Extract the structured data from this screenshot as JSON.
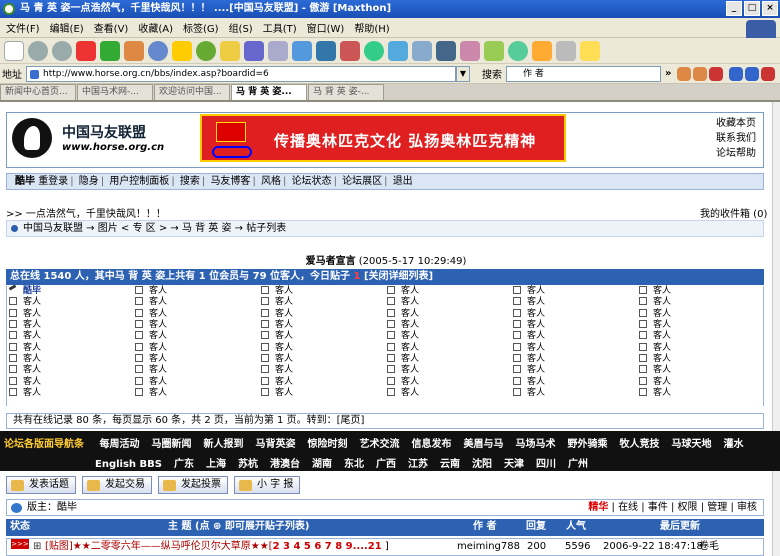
{
  "window": {
    "title": "马 青 英 姿一点浩然气，千里快哉风！！！ ....[中国马友联盟] - 傲游 [Maxthon]"
  },
  "menu": [
    "文件(F)",
    "编辑(E)",
    "查看(V)",
    "收藏(A)",
    "标签(G)",
    "组(S)",
    "工具(T)",
    "窗口(W)",
    "帮助(H)"
  ],
  "address": {
    "label": "地址",
    "url": "http://www.horse.org.cn/bbs/index.asp?boardid=6",
    "search_label": "搜索",
    "search_value": "作 者"
  },
  "tabs": [
    "新闻中心首页...",
    "中国马术网-...",
    "欢迎访问中国...",
    "马 背 英 姿...",
    "马 背 英 姿-..."
  ],
  "site": {
    "name": "中国马友联盟",
    "domain": "www.horse.org.cn",
    "banner_slogan": "传播奥林匹克文化 弘扬奥林匹克精神",
    "side_links": [
      "收藏本页",
      "联系我们",
      "论坛帮助"
    ]
  },
  "nav": [
    "酷毕",
    "重登录",
    "隐身",
    "用户控制面板",
    "搜索",
    "马友博客",
    "风格",
    "论坛状态",
    "论坛展区",
    "退出"
  ],
  "slogan": ">> 一点浩然气，千里快哉风！！！",
  "inbox": "我的收件箱 (0)",
  "breadcrumb": "中国马友联盟 → 图片 < 专 区 > → 马 背 英 姿 → 帖子列表",
  "announcement": {
    "title": "爱马者宣言",
    "date": "(2005-5-17 10:29:49)"
  },
  "online": {
    "prefix": "总在线 1540 人，其中马 背 英 姿上共有 1 位会员与 79 位客人，今日贴子 ",
    "today_posts": "1",
    "link": "[关闭详细列表]"
  },
  "online_grid": {
    "member": "酷毕",
    "guest": "客人"
  },
  "pager": "共有在线记录 80 条，每页显示 60 条，共 2 页，当前为第 1 页。转到：[尾页]",
  "categories": {
    "lead": "论坛各版面导航条",
    "row1": [
      "每周活动",
      "马圈新闻",
      "新人报到",
      "马背英姿",
      "惊险时刻",
      "艺术交流",
      "信息发布",
      "美眉与马",
      "马场马术",
      "野外骑乘",
      "牧人竞技",
      "马球天地",
      "灌水"
    ],
    "row2": [
      "English BBS",
      "广东",
      "上海",
      "苏杭",
      "港澳台",
      "湖南",
      "东北",
      "广西",
      "江苏",
      "云南",
      "沈阳",
      "天津",
      "四川",
      "广州"
    ]
  },
  "actions": [
    "发表话题",
    "发起交易",
    "发起投票",
    "小 字 报"
  ],
  "moderator": {
    "label": "版主：",
    "name": "酷毕",
    "links": [
      "精华",
      "在线",
      "事件",
      "权限",
      "管理",
      "审核"
    ]
  },
  "table_head": {
    "status": "状态",
    "topic": "主 题 (点 ⊕ 即可展开贴子列表)",
    "author": "作 者",
    "replies": "回复",
    "views": "人气",
    "last": "最后更新"
  },
  "post": {
    "badge": ">>>",
    "title": "[贴图]★★二零零六年——纵马呼伦贝尔大草原★★[",
    "pages": "2 3 4 5 6 7 8 9....21",
    "title_end": " ]",
    "author": "meiming788",
    "replies": "200",
    "views": "5596",
    "last_time": "2006-9-22 18:47:18",
    "last_user": "卷毛"
  }
}
